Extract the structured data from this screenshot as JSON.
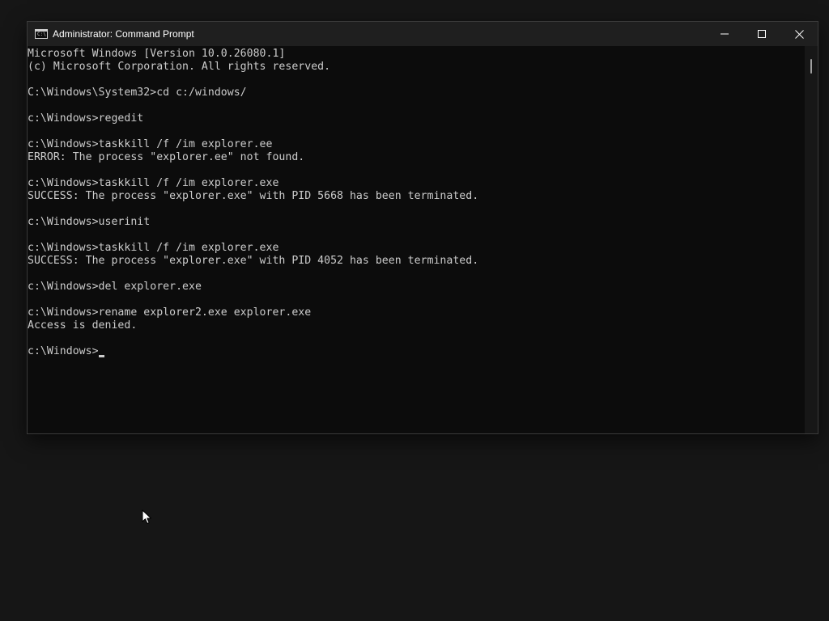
{
  "window": {
    "title": "Administrator: Command Prompt",
    "app_icon_glyph": "C:\\",
    "icons": {
      "app": "command-prompt-icon",
      "minimize": "minimize-icon",
      "maximize": "maximize-icon",
      "close": "close-icon"
    }
  },
  "console": {
    "lines": [
      "Microsoft Windows [Version 10.0.26080.1]",
      "(c) Microsoft Corporation. All rights reserved.",
      "",
      "C:\\Windows\\System32>cd c:/windows/",
      "",
      "c:\\Windows>regedit",
      "",
      "c:\\Windows>taskkill /f /im explorer.ee",
      "ERROR: The process \"explorer.ee\" not found.",
      "",
      "c:\\Windows>taskkill /f /im explorer.exe",
      "SUCCESS: The process \"explorer.exe\" with PID 5668 has been terminated.",
      "",
      "c:\\Windows>userinit",
      "",
      "c:\\Windows>taskkill /f /im explorer.exe",
      "SUCCESS: The process \"explorer.exe\" with PID 4052 has been terminated.",
      "",
      "c:\\Windows>del explorer.exe",
      "",
      "c:\\Windows>rename explorer2.exe explorer.exe",
      "Access is denied.",
      ""
    ],
    "current_prompt": "c:\\Windows>",
    "input_value": ""
  },
  "colors": {
    "desktop_bg": "#161616",
    "console_bg": "#0c0c0c",
    "console_text": "#cccccc",
    "titlebar_bg": "#1f1f1f"
  }
}
